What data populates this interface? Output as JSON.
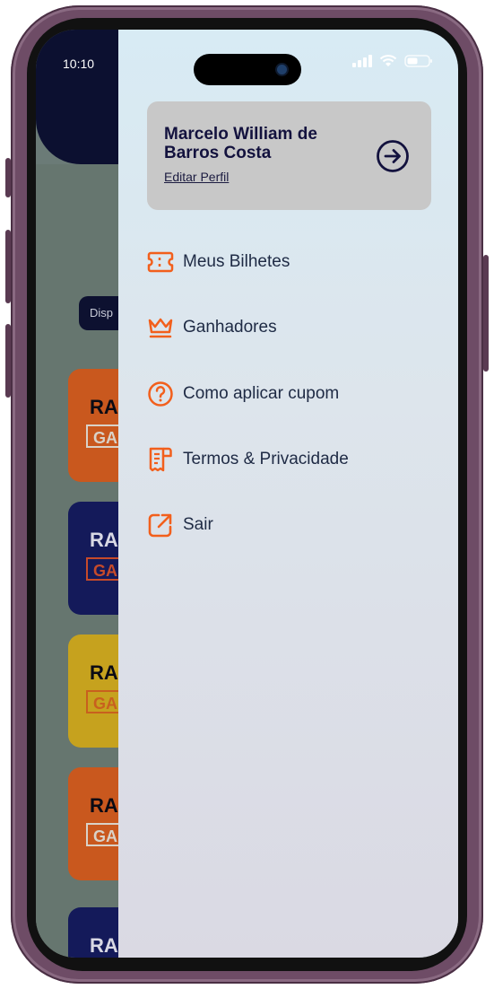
{
  "status_bar": {
    "time": "10:10"
  },
  "background_app": {
    "filter_pill": "Disp",
    "cards": [
      {
        "title": "RA",
        "badge": "GA",
        "color": "#c9581e",
        "badge_color": "#d9d2c8",
        "text_color": "#0b0b14"
      },
      {
        "title": "RA",
        "badge": "GA",
        "color": "#141a5a",
        "badge_color": "#c64a2a",
        "text_color": "#d8d8e4"
      },
      {
        "title": "RA",
        "badge": "GA",
        "color": "#c6a21e",
        "badge_color": "#c8601e",
        "text_color": "#0b0b14"
      },
      {
        "title": "RA",
        "badge": "GA",
        "color": "#c9581e",
        "badge_color": "#d9d2c8",
        "text_color": "#0b0b14"
      },
      {
        "title": "RA",
        "badge": "",
        "color": "#141a5a",
        "badge_color": "#c64a2a",
        "text_color": "#d8d8e4"
      }
    ]
  },
  "drawer": {
    "profile": {
      "name": "Marcelo William de Barros Costa",
      "edit_label": "Editar Perfil"
    },
    "menu": [
      {
        "label": "Meus Bilhetes",
        "icon": "ticket-icon"
      },
      {
        "label": "Ganhadores",
        "icon": "crown-icon"
      },
      {
        "label": "Como aplicar cupom",
        "icon": "help-circle-icon"
      },
      {
        "label": "Termos & Privacidade",
        "icon": "receipt-icon"
      },
      {
        "label": "Sair",
        "icon": "external-link-icon"
      }
    ]
  },
  "colors": {
    "accent_orange": "#f25f1c",
    "navy": "#13123e",
    "text": "#1e2a44"
  }
}
